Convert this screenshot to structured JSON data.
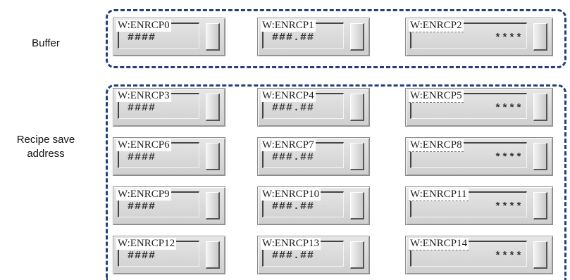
{
  "labels": {
    "buffer": "Buffer",
    "recipe_line1": "Recipe save",
    "recipe_line2": "address"
  },
  "buffer_fields": [
    {
      "address": "W:ENRCP0",
      "format": "####"
    },
    {
      "address": "W:ENRCP1",
      "format": "###.##"
    },
    {
      "address": "W:ENRCP2",
      "format": "****"
    }
  ],
  "recipe_fields": [
    {
      "address": "W:ENRCP3",
      "format": "####"
    },
    {
      "address": "W:ENRCP4",
      "format": "###.##"
    },
    {
      "address": "W:ENRCP5",
      "format": "****"
    },
    {
      "address": "W:ENRCP6",
      "format": "####"
    },
    {
      "address": "W:ENRCP7",
      "format": "###.##"
    },
    {
      "address": "W:ENRCP8",
      "format": "****"
    },
    {
      "address": "W:ENRCP9",
      "format": "####"
    },
    {
      "address": "W:ENRCP10",
      "format": "###.##"
    },
    {
      "address": "W:ENRCP11",
      "format": "****"
    },
    {
      "address": "W:ENRCP12",
      "format": "####"
    },
    {
      "address": "W:ENRCP13",
      "format": "###.##"
    },
    {
      "address": "W:ENRCP14",
      "format": "****"
    }
  ],
  "colors": {
    "group_border": "#24407a",
    "field_bg": "#dcdcdc"
  }
}
